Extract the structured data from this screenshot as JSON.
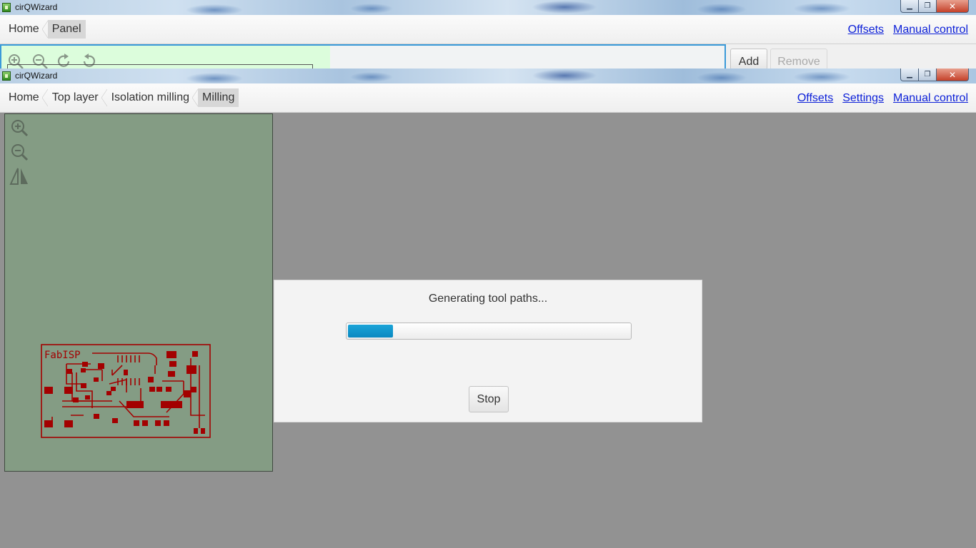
{
  "background_window": {
    "title": "cirQWizard",
    "breadcrumbs": [
      "Home",
      "Panel"
    ],
    "links": [
      "Offsets",
      "Manual control"
    ],
    "buttons": {
      "add": "Add",
      "remove": "Remove"
    }
  },
  "window": {
    "title": "cirQWizard",
    "breadcrumbs": [
      "Home",
      "Top layer",
      "Isolation milling",
      "Milling"
    ],
    "links": {
      "offsets": "Offsets",
      "settings": "Settings",
      "manual_control": "Manual control"
    }
  },
  "board": {
    "label": "FabISP"
  },
  "dialog": {
    "message": "Generating tool paths...",
    "progress": 0.16,
    "stop_label": "Stop"
  },
  "colors": {
    "canvas": "#849c84",
    "trace": "#a30000",
    "progress": "#0e93c9",
    "link": "#0b1fd8"
  },
  "icons": [
    "zoom-in-icon",
    "zoom-out-icon",
    "flip-icon",
    "rotate-cw-icon",
    "rotate-ccw-icon"
  ]
}
